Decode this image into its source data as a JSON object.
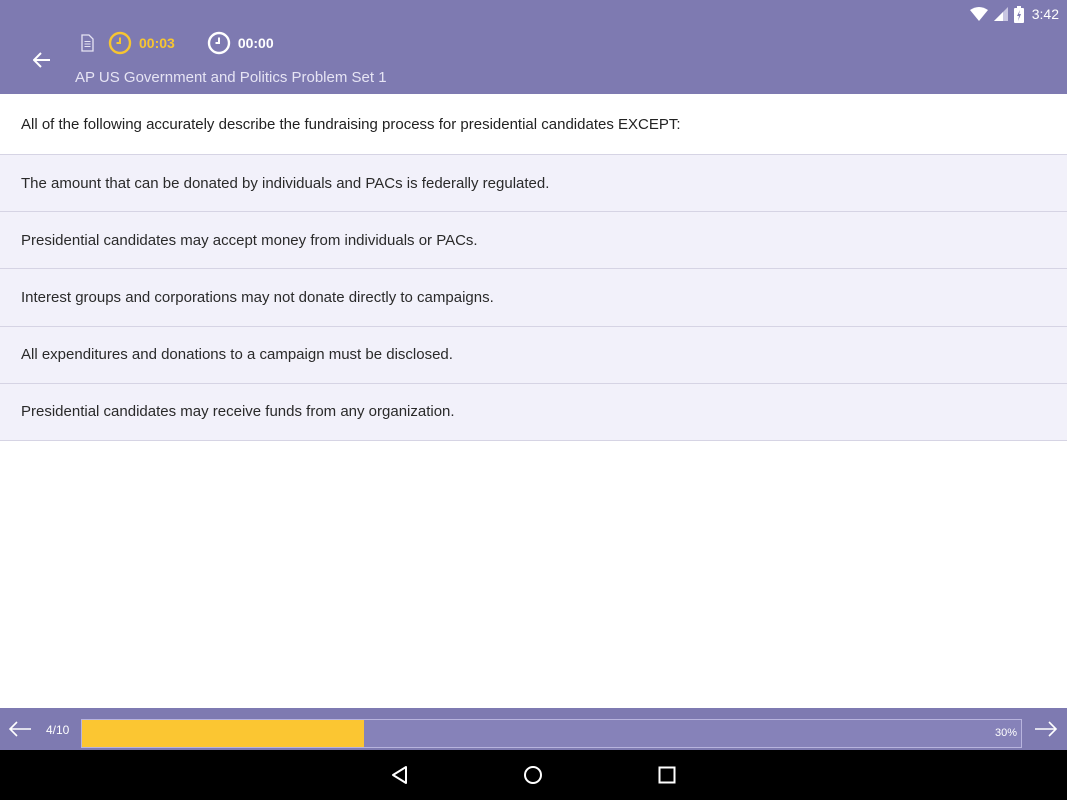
{
  "status_bar": {
    "time": "3:42"
  },
  "header": {
    "active_timer": "00:03",
    "total_timer": "00:00",
    "title": "AP US Government and Politics Problem Set 1"
  },
  "question": {
    "text": "All of the following accurately describe the fundraising process for presidential candidates EXCEPT:"
  },
  "answers": [
    "The amount that can be donated by individuals and PACs is federally regulated.",
    "Presidential candidates may accept money from individuals or PACs.",
    "Interest groups and corporations may not donate directly to campaigns.",
    "All expenditures and donations to a campaign must be disclosed.",
    "Presidential candidates may receive funds from any organization."
  ],
  "progress": {
    "counter": "4/10",
    "label": "30%",
    "fill_fraction": 0.3
  },
  "colors": {
    "header": "#7e7ab1",
    "accent": "#f7c531",
    "answer_bg": "#f2f1fa"
  },
  "icons": [
    "wifi-icon",
    "signal-icon",
    "battery-icon",
    "back-arrow-icon",
    "document-icon",
    "clock-icon",
    "left-arrow-icon",
    "right-arrow-icon",
    "nav-back-icon",
    "nav-home-icon",
    "nav-recents-icon"
  ]
}
